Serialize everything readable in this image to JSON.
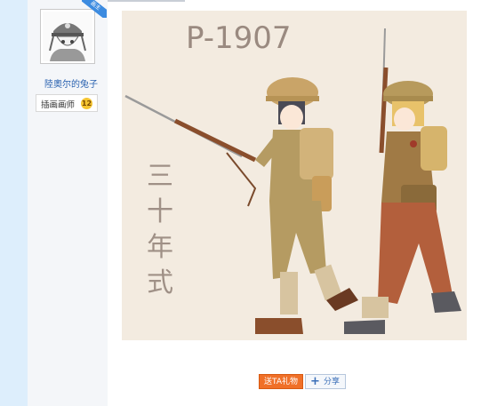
{
  "profile": {
    "name": "陸奧尔的兔子",
    "role": "插画画师",
    "level": "12",
    "badge": "画主"
  },
  "artwork": {
    "title_text": "P-1907",
    "vertical_text": "三十年式"
  },
  "actions": {
    "gift_label": "送TA礼物",
    "share_label": "分享",
    "share_icon": "plus-icon"
  },
  "colors": {
    "accent_orange": "#f07028",
    "link_blue": "#2a62b0",
    "rail_blue": "#ddeefc",
    "canvas_beige": "#f3ebe0"
  }
}
